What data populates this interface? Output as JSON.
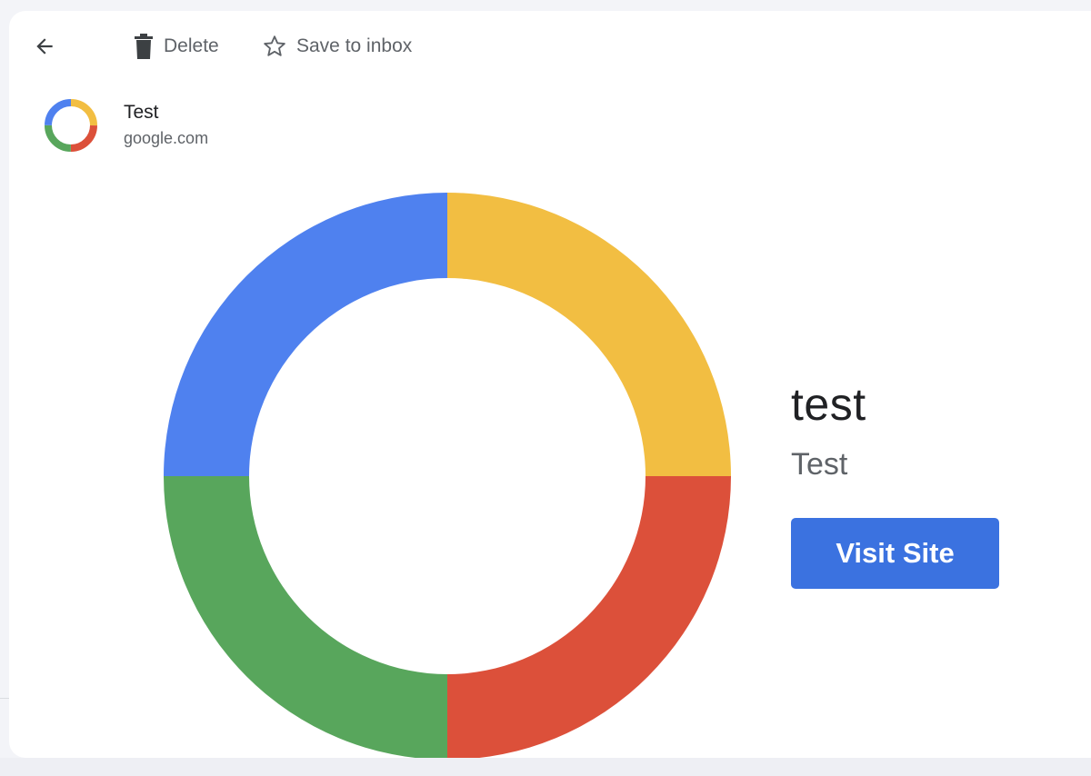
{
  "toolbar": {
    "back_icon": "arrow-back-icon",
    "delete_label": "Delete",
    "delete_icon": "trash-icon",
    "save_label": "Save to inbox",
    "save_icon": "star-outline-icon"
  },
  "sender": {
    "name": "Test",
    "domain": "google.com",
    "avatar_icon": "google-ring-logo"
  },
  "promo": {
    "title": "test",
    "subtitle": "Test",
    "button_label": "Visit Site"
  },
  "colors": {
    "blue": "#4f81ef",
    "yellow": "#f2be42",
    "red": "#dc503a",
    "green": "#58a65c",
    "button": "#3b72e0"
  }
}
